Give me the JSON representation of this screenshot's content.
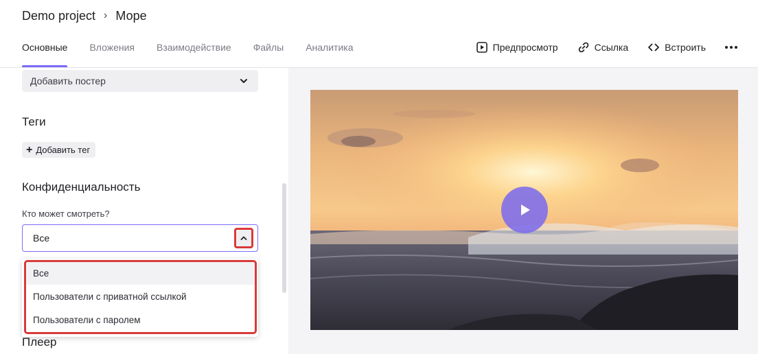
{
  "breadcrumb": {
    "project": "Demo project",
    "separator": "›",
    "page": "Море"
  },
  "tabs": [
    {
      "label": "Основные",
      "active": true
    },
    {
      "label": "Вложения"
    },
    {
      "label": "Взаимодействие"
    },
    {
      "label": "Файлы"
    },
    {
      "label": "Аналитика"
    }
  ],
  "actions": {
    "preview": "Предпросмотр",
    "link": "Ссылка",
    "embed": "Встроить"
  },
  "poster": {
    "label": "Добавить постер"
  },
  "tags": {
    "title": "Теги",
    "add_label": "Добавить тег"
  },
  "privacy": {
    "title": "Конфиденциальность",
    "question": "Кто может смотреть?",
    "selected": "Все",
    "options": [
      "Все",
      "Пользователи с приватной ссылкой",
      "Пользователи с паролем"
    ]
  },
  "player": {
    "title": "Плеер"
  },
  "colors": {
    "accent": "#7b6cf6",
    "highlight": "#d93a3a"
  }
}
